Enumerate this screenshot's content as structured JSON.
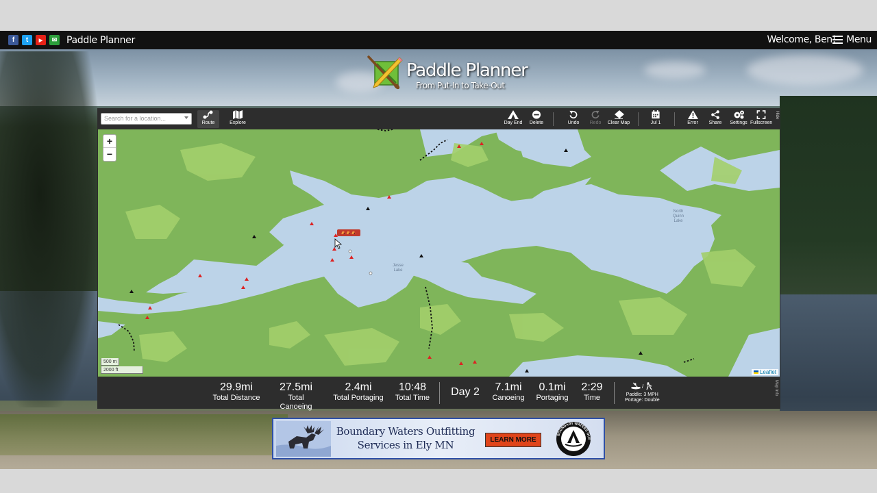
{
  "topbar": {
    "social": [
      {
        "name": "facebook",
        "glyph": "f",
        "color": "#3b5998"
      },
      {
        "name": "twitter",
        "glyph": "t",
        "color": "#1da1f2"
      },
      {
        "name": "youtube",
        "glyph": "▶",
        "color": "#e62117"
      },
      {
        "name": "email",
        "glyph": "✉",
        "color": "#2c9e3b"
      }
    ],
    "brand": "Paddle Planner",
    "welcome": "Welcome, Ben!",
    "menu_label": "Menu"
  },
  "logo": {
    "title": "Paddle Planner",
    "subtitle": "From Put-In to Take-Out"
  },
  "toolbar": {
    "search_placeholder": "Search for a location...",
    "route": "Route",
    "explore": "Explore",
    "day_end": "Day End",
    "delete": "Delete",
    "undo": "Undo",
    "redo": "Redo",
    "clear_map": "Clear Map",
    "date": "Jul 1",
    "error": "Error",
    "share": "Share",
    "settings": "Settings",
    "fullscreen": "Fullscreen",
    "more": "Hide"
  },
  "map": {
    "zoom_in": "+",
    "zoom_out": "−",
    "scale_metric": "500 m",
    "scale_imperial": "2000 ft",
    "attribution": "Leaflet",
    "lakes": [
      {
        "name": "Jesse Lake"
      },
      {
        "name": "North Quinn Lake"
      }
    ],
    "colors": {
      "water": "#bcd3e8",
      "land": "#7fb55a",
      "land_light": "#a3cf6b"
    }
  },
  "stats": {
    "total_distance": {
      "value": "29.9mi",
      "label": "Total Distance"
    },
    "total_canoeing": {
      "value": "27.5mi",
      "label": "Total Canoeing"
    },
    "total_portaging": {
      "value": "2.4mi",
      "label": "Total Portaging"
    },
    "total_time": {
      "value": "10:48",
      "label": "Total Time"
    },
    "day": "Day 2",
    "canoeing": {
      "value": "7.1mi",
      "label": "Canoeing"
    },
    "portaging": {
      "value": "0.1mi",
      "label": "Portaging"
    },
    "time": {
      "value": "2:29",
      "label": "Time"
    },
    "paddle_pace": "Paddle: 3 MPH",
    "portage_pace": "Portage: Double",
    "map_info": "Map Info"
  },
  "ad": {
    "line1": "Boundary Waters Outfitting",
    "line2": "Services in Ely MN",
    "button": "LEARN MORE",
    "badge_text": "BOUNDARY WATERS OUTFITTERS"
  }
}
